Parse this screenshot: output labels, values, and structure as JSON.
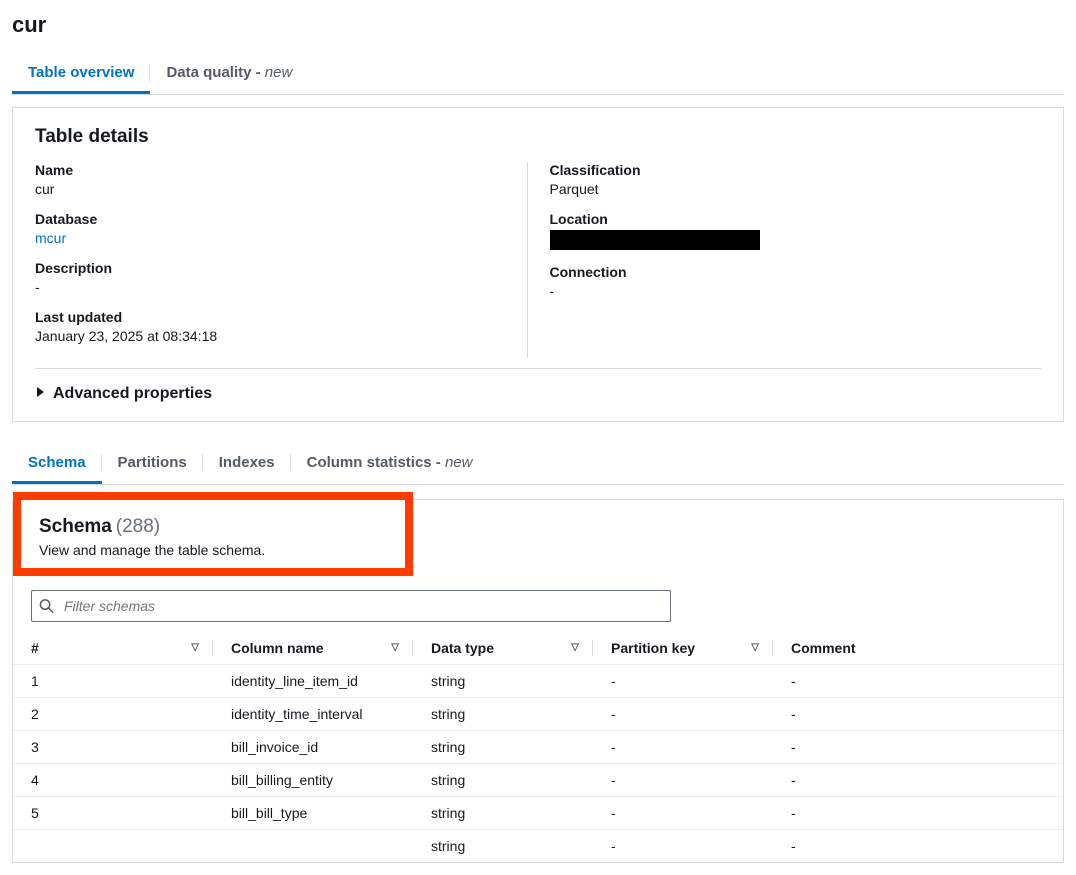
{
  "page_title": "cur",
  "top_tabs": [
    {
      "label": "Table overview",
      "active": true
    },
    {
      "label_prefix": "Data quality - ",
      "label_suffix": "new",
      "active": false
    }
  ],
  "table_details": {
    "title": "Table details",
    "left": {
      "name_label": "Name",
      "name_value": "cur",
      "database_label": "Database",
      "database_value": "mcur",
      "description_label": "Description",
      "description_value": "-",
      "last_updated_label": "Last updated",
      "last_updated_value": "January 23, 2025 at 08:34:18"
    },
    "right": {
      "classification_label": "Classification",
      "classification_value": "Parquet",
      "location_label": "Location",
      "connection_label": "Connection",
      "connection_value": "-"
    },
    "advanced_label": "Advanced properties"
  },
  "sub_tabs": [
    {
      "label": "Schema",
      "active": true
    },
    {
      "label": "Partitions",
      "active": false
    },
    {
      "label": "Indexes",
      "active": false
    },
    {
      "label_prefix": "Column statistics - ",
      "label_suffix": "new",
      "active": false
    }
  ],
  "schema": {
    "title": "Schema",
    "count_display": "(288)",
    "subtitle": "View and manage the table schema.",
    "filter_placeholder": "Filter schemas",
    "headers": {
      "num": "#",
      "col": "Column name",
      "type": "Data type",
      "pk": "Partition key",
      "comment": "Comment"
    },
    "rows": [
      {
        "n": "1",
        "name": "identity_line_item_id",
        "type": "string",
        "pk": "-",
        "comment": "-"
      },
      {
        "n": "2",
        "name": "identity_time_interval",
        "type": "string",
        "pk": "-",
        "comment": "-"
      },
      {
        "n": "3",
        "name": "bill_invoice_id",
        "type": "string",
        "pk": "-",
        "comment": "-"
      },
      {
        "n": "4",
        "name": "bill_billing_entity",
        "type": "string",
        "pk": "-",
        "comment": "-"
      },
      {
        "n": "5",
        "name": "bill_bill_type",
        "type": "string",
        "pk": "-",
        "comment": "-"
      },
      {
        "n": "",
        "name": "",
        "type": "string",
        "pk": "-",
        "comment": "-"
      }
    ]
  }
}
